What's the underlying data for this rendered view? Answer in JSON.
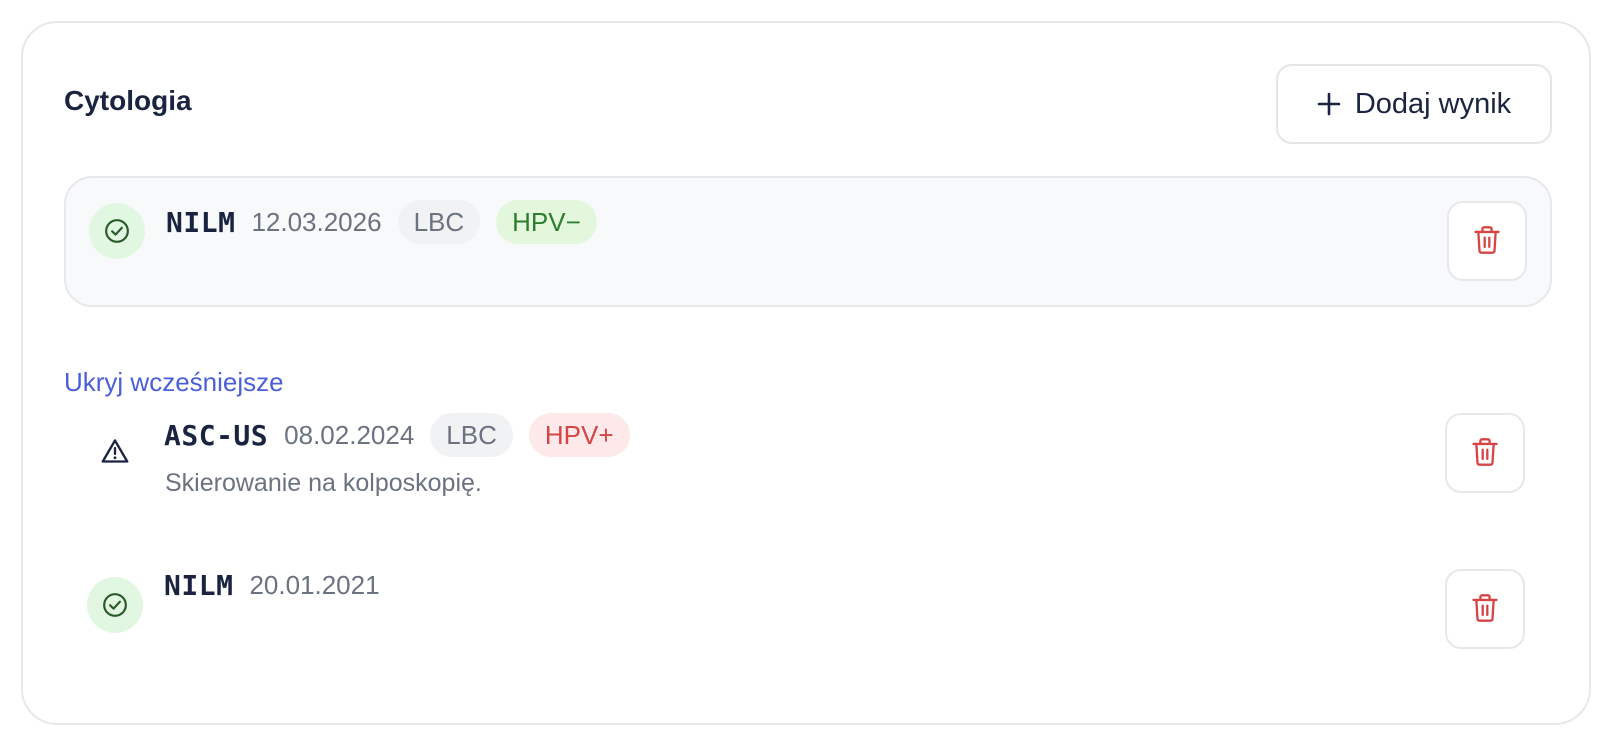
{
  "section": {
    "title": "Cytologia",
    "add_button_label": "Dodaj wynik"
  },
  "latest": {
    "code": "NILM",
    "date": "12.03.2026",
    "method": "LBC",
    "hpv": "HPV−",
    "status": "ok",
    "status_icon": "check-circle-icon"
  },
  "toggle_label": "Ukryj wcześniejsze",
  "history": [
    {
      "code": "ASC-US",
      "date": "08.02.2024",
      "method": "LBC",
      "hpv": "HPV+",
      "note": "Skierowanie na kolposkopię.",
      "status": "warn",
      "status_icon": "warning-triangle-icon"
    },
    {
      "code": "NILM",
      "date": "20.01.2021",
      "status": "ok",
      "status_icon": "check-circle-icon"
    }
  ],
  "colors": {
    "accent_link": "#4b5fd6",
    "ok_green": "#2e7d2e",
    "ok_bg": "#e1f7e1",
    "danger_red": "#d64545",
    "danger_bg": "#fde9ea",
    "text_dark": "#1a2340",
    "text_muted": "#6b7280"
  }
}
